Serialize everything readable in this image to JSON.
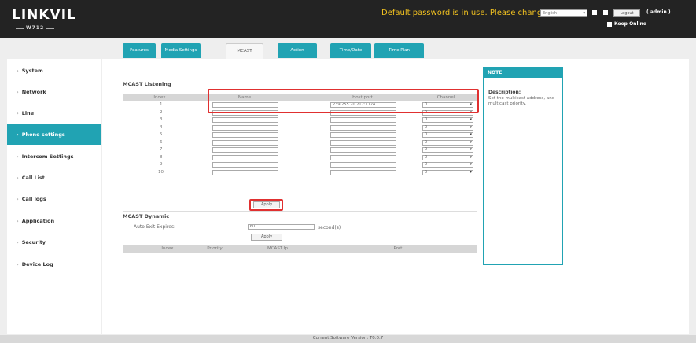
{
  "header": {
    "logo": "LINKVIL",
    "model": "W712",
    "warning": "Default password is in use. Please change",
    "language": "English",
    "logout": "Logout",
    "user": "( admin )",
    "keep_online": "Keep Online"
  },
  "tabs": [
    {
      "label": "Features",
      "active": false
    },
    {
      "label": "Media Settings",
      "active": false
    },
    {
      "label": "MCAST",
      "active": true
    },
    {
      "label": "Action",
      "active": false
    },
    {
      "label": "Time/Date",
      "active": false
    },
    {
      "label": "Time Plan",
      "active": false
    }
  ],
  "sidebar": [
    {
      "label": "System"
    },
    {
      "label": "Network"
    },
    {
      "label": "Line"
    },
    {
      "label": "Phone settings",
      "active": true
    },
    {
      "label": "Intercom Settings"
    },
    {
      "label": "Call List"
    },
    {
      "label": "Call logs"
    },
    {
      "label": "Application"
    },
    {
      "label": "Security"
    },
    {
      "label": "Device Log"
    }
  ],
  "listening": {
    "title": "MCAST Listening",
    "columns": [
      "Index",
      "Name",
      "Host:port",
      "Channel"
    ],
    "rows": [
      {
        "index": "1",
        "name": "",
        "host": "239.255.20.212:1124",
        "channel": "0"
      },
      {
        "index": "2",
        "name": "",
        "host": "",
        "channel": "0"
      },
      {
        "index": "3",
        "name": "",
        "host": "",
        "channel": "0"
      },
      {
        "index": "4",
        "name": "",
        "host": "",
        "channel": "0"
      },
      {
        "index": "5",
        "name": "",
        "host": "",
        "channel": "0"
      },
      {
        "index": "6",
        "name": "",
        "host": "",
        "channel": "0"
      },
      {
        "index": "7",
        "name": "",
        "host": "",
        "channel": "0"
      },
      {
        "index": "8",
        "name": "",
        "host": "",
        "channel": "0"
      },
      {
        "index": "9",
        "name": "",
        "host": "",
        "channel": "0"
      },
      {
        "index": "10",
        "name": "",
        "host": "",
        "channel": "0"
      }
    ],
    "apply": "Apply"
  },
  "dynamic": {
    "title": "MCAST Dynamic",
    "auto_exit_label": "Auto Exit Expires:",
    "auto_exit_value": "60",
    "unit": "second(s)",
    "apply": "Apply",
    "columns": [
      "Index",
      "Priority",
      "MCAST Ip",
      "Port"
    ]
  },
  "note": {
    "head": "NOTE",
    "title": "Description:",
    "text": "Set the multicast address, and multicast priority."
  },
  "footer": {
    "version": "Current Software Version: T0.0.7"
  },
  "colors": {
    "accent": "#21a3b3",
    "highlight": "#e03030",
    "warning": "#f0c020"
  }
}
